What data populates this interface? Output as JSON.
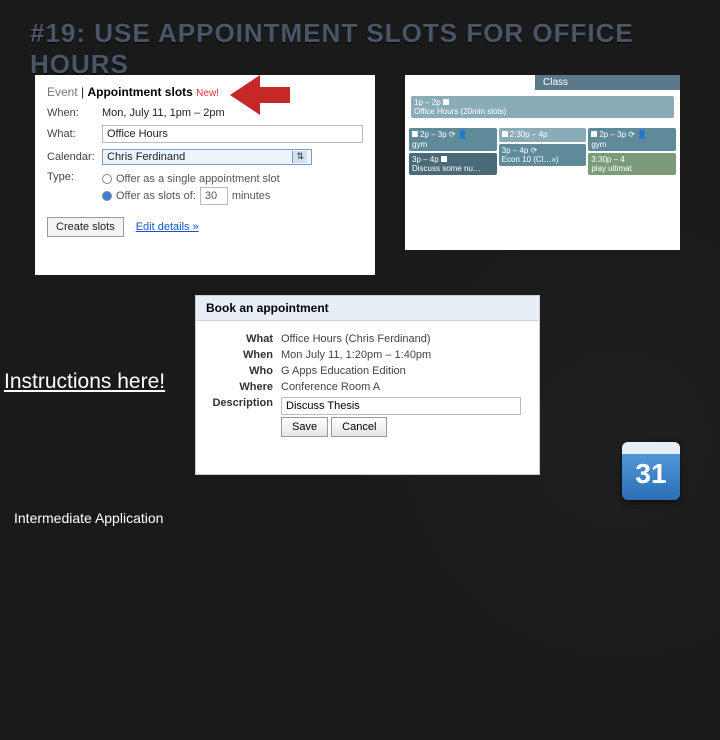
{
  "title": "#19: USE APPOINTMENT SLOTS FOR OFFICE HOURS",
  "panelA": {
    "tab_event": "Event",
    "tab_slots": "Appointment slots",
    "new_label": "New!",
    "when_lbl": "When:",
    "when_val": "Mon, July 11, 1pm – 2pm",
    "what_lbl": "What:",
    "what_val": "Office Hours",
    "cal_lbl": "Calendar:",
    "cal_val": "Chris Ferdinand",
    "type_lbl": "Type:",
    "type_single": "Offer as a single appointment slot",
    "type_slots": "Offer as slots of:",
    "slot_min": "30",
    "min_lbl": "minutes",
    "create_btn": "Create slots",
    "edit_link": "Edit details »"
  },
  "panelB": {
    "class": "Class",
    "oh_range": "1p – 2p",
    "oh_label": "Office Hours (20min slots)",
    "ev1": "2p – 3p",
    "ev1b": "gym",
    "ev2": "2:30p – 4p",
    "ev3": "3p – 4p",
    "ev4": "Discuss some nu…",
    "ev5": "Econ 10 (Cl…»)",
    "ev6": "2p – 3p",
    "ev6b": "gym",
    "ev7": "3:30p – 4",
    "ev7b": "play ultimat"
  },
  "panelC": {
    "header": "Book an appointment",
    "what_lbl": "What",
    "what_val": "Office Hours (Chris Ferdinand)",
    "when_lbl": "When",
    "when_val": "Mon July 11, 1:20pm – 1:40pm",
    "who_lbl": "Who",
    "who_val": "G Apps Education Edition",
    "where_lbl": "Where",
    "where_val": "Conference Room A",
    "desc_lbl": "Description",
    "desc_val": "Discuss Thesis",
    "save": "Save",
    "cancel": "Cancel"
  },
  "instructions": "Instructions here!",
  "footer": "Intermediate Application",
  "cal_icon_day": "31"
}
